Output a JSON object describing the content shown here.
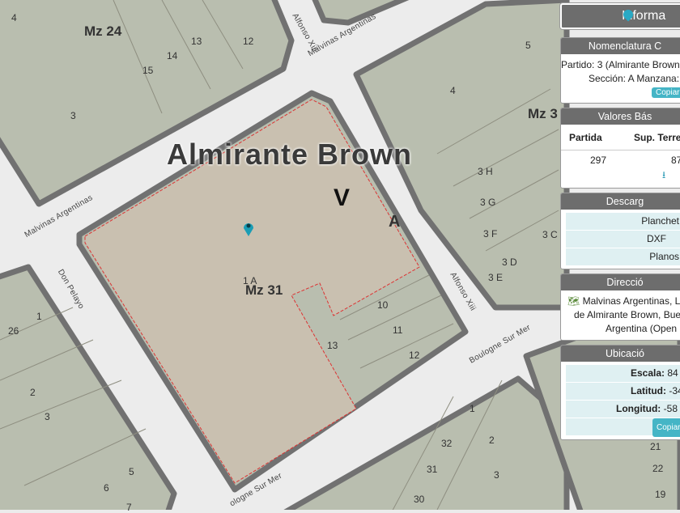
{
  "map": {
    "title": "Almirante Brown",
    "section_letter": "V",
    "fraction": "A",
    "blocks": [
      "Mz 24",
      "Mz 31",
      "Mz 3"
    ],
    "streets": [
      "Malvinas Argentinas",
      "Malvinas Argentinas",
      "Alfonso Xiii",
      "Alfonso Xiii",
      "Don Pelayo",
      "Boulogne Sur Mer",
      "ologne Sur Mer"
    ],
    "parcels": [
      "4",
      "13",
      "12",
      "14",
      "15",
      "3",
      "5",
      "4",
      "3 H",
      "3 G",
      "3 F",
      "3 C",
      "3 D",
      "3 E",
      "1 A",
      "10",
      "11",
      "13",
      "12",
      "1",
      "26",
      "2",
      "3",
      "5",
      "6",
      "7",
      "1",
      "2",
      "32",
      "3",
      "31",
      "30",
      "21",
      "22",
      "19"
    ],
    "colors": {
      "block": "#b9beaf",
      "selected": "#c9c0b0",
      "border": "#717171",
      "street": "#ececec"
    }
  },
  "panel": {
    "title": "Informa",
    "nomenclatura": {
      "header": "Nomenclatura C",
      "line1": "Partido: 3 (Almirante Brown",
      "line2": "Sección: A Manzana:",
      "copy": "Copiar"
    },
    "valores": {
      "header": "Valores Bás",
      "col1": "Partida",
      "col2": "Sup. Terre",
      "val1": "297",
      "val2": "87"
    },
    "descargas": {
      "header": "Descarg",
      "items": [
        "Planchet",
        "DXF",
        "Planos"
      ]
    },
    "direccion": {
      "header": "Direcció",
      "line1": "Malvinas Argentinas, L",
      "line2": "de Almirante Brown, Bue",
      "line3": "Argentina (Open S"
    },
    "ubicacion": {
      "header": "Ubicació",
      "escala_label": "Escala:",
      "escala": "84",
      "lat_label": "Latitud:",
      "lat": "-34",
      "lon_label": "Longitud:",
      "lon": "-58",
      "copy": "Copiar"
    }
  }
}
